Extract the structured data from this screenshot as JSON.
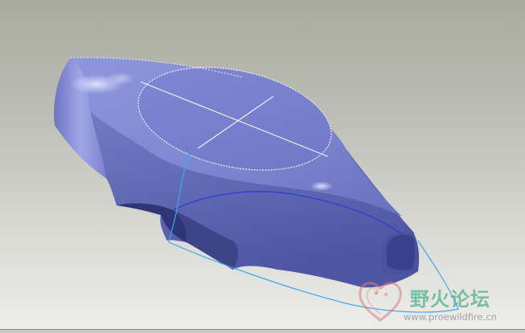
{
  "watermark": {
    "title": "野火论坛",
    "url": "www.proewildfire.cn",
    "logo_icon": "heart-logo-icon",
    "title_color": "#58b296"
  },
  "colors": {
    "background_top": "#a9aaa0",
    "background_bottom": "#eeeeea",
    "surface": "#7d84cd",
    "sketch_line": "#3fa6ee",
    "edge_line": "#f2f2ea"
  }
}
